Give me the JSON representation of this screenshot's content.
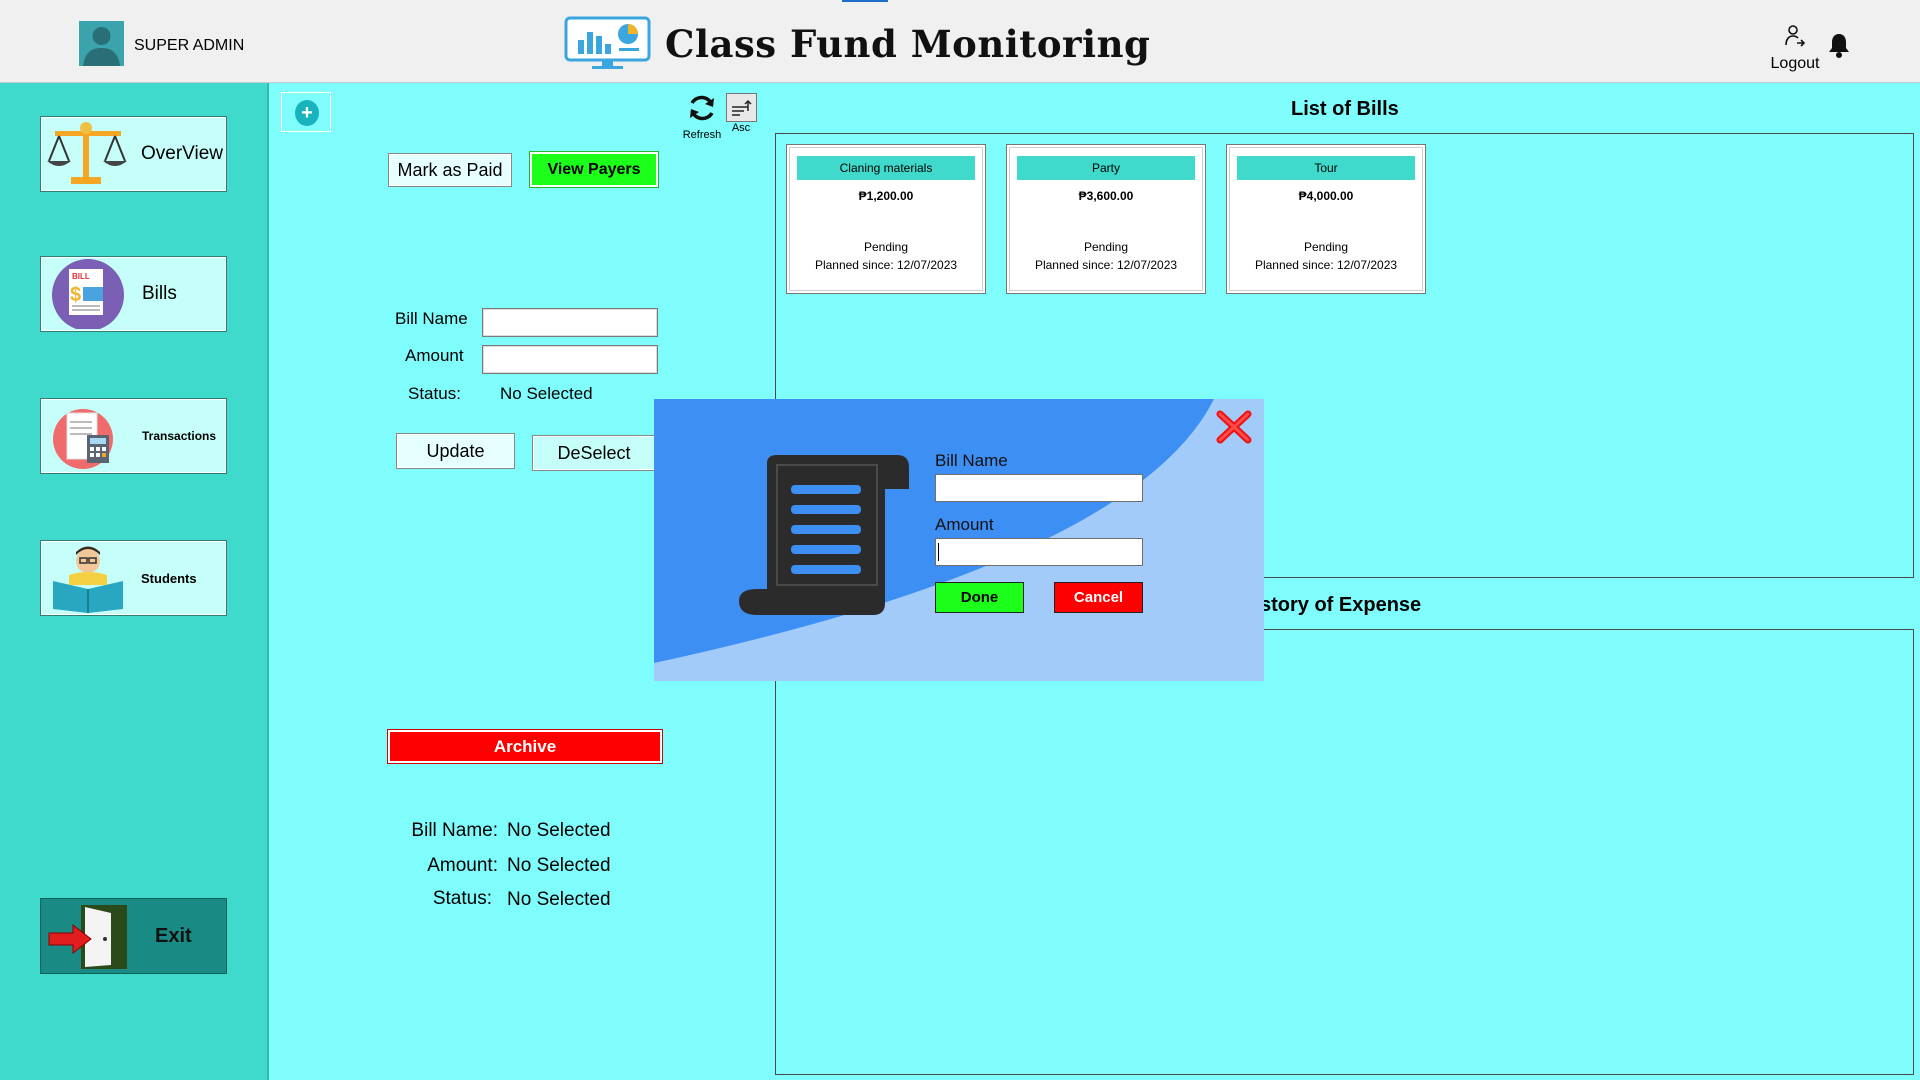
{
  "header": {
    "user": "SUPER ADMIN",
    "title": "Class Fund Monitoring",
    "logout_label": "Logout"
  },
  "sidebar": {
    "items": [
      {
        "label": "OverView",
        "icon": "scales-icon"
      },
      {
        "label": "Bills",
        "icon": "bill-icon"
      },
      {
        "label": "Transactions",
        "icon": "calculator-receipt-icon"
      },
      {
        "label": "Students",
        "icon": "student-reading-icon"
      }
    ],
    "exit_label": "Exit"
  },
  "toolbar": {
    "refresh_label": "Refresh",
    "sort_label": "Asc"
  },
  "form": {
    "mark_paid_label": "Mark as Paid",
    "view_payers_label": "View Payers",
    "bill_name_label": "Bill Name",
    "bill_name_value": "",
    "amount_label": "Amount",
    "amount_value": "",
    "status_label": "Status:",
    "status_value": "No Selected",
    "update_label": "Update",
    "deselect_label": "DeSelect",
    "archive_label": "Archive"
  },
  "summary": {
    "bill_name_label": "Bill Name:",
    "bill_name_value": "No Selected",
    "amount_label": "Amount:",
    "amount_value": "No Selected",
    "status_label": "Status:",
    "status_value": "No Selected"
  },
  "bills": {
    "title": "List of Bills",
    "cards": [
      {
        "name": "Claning materials",
        "amount": "₱1,200.00",
        "status": "Pending",
        "date": "Planned since: 12/07/2023"
      },
      {
        "name": "Party",
        "amount": "₱3,600.00",
        "status": "Pending",
        "date": "Planned since: 12/07/2023"
      },
      {
        "name": "Tour",
        "amount": "₱4,000.00",
        "status": "Pending",
        "date": "Planned since: 12/07/2023"
      }
    ]
  },
  "expense": {
    "title": "History of Expense"
  },
  "modal": {
    "bill_name_label": "Bill Name",
    "bill_name_value": "",
    "amount_label": "Amount",
    "amount_value": "",
    "done_label": "Done",
    "cancel_label": "Cancel"
  },
  "colors": {
    "background": "#7ffdfd",
    "sidebar": "#3fdacb",
    "accent_green": "#1bff1b",
    "accent_red": "#ff0000",
    "modal_blue": "#3d8ff3"
  }
}
